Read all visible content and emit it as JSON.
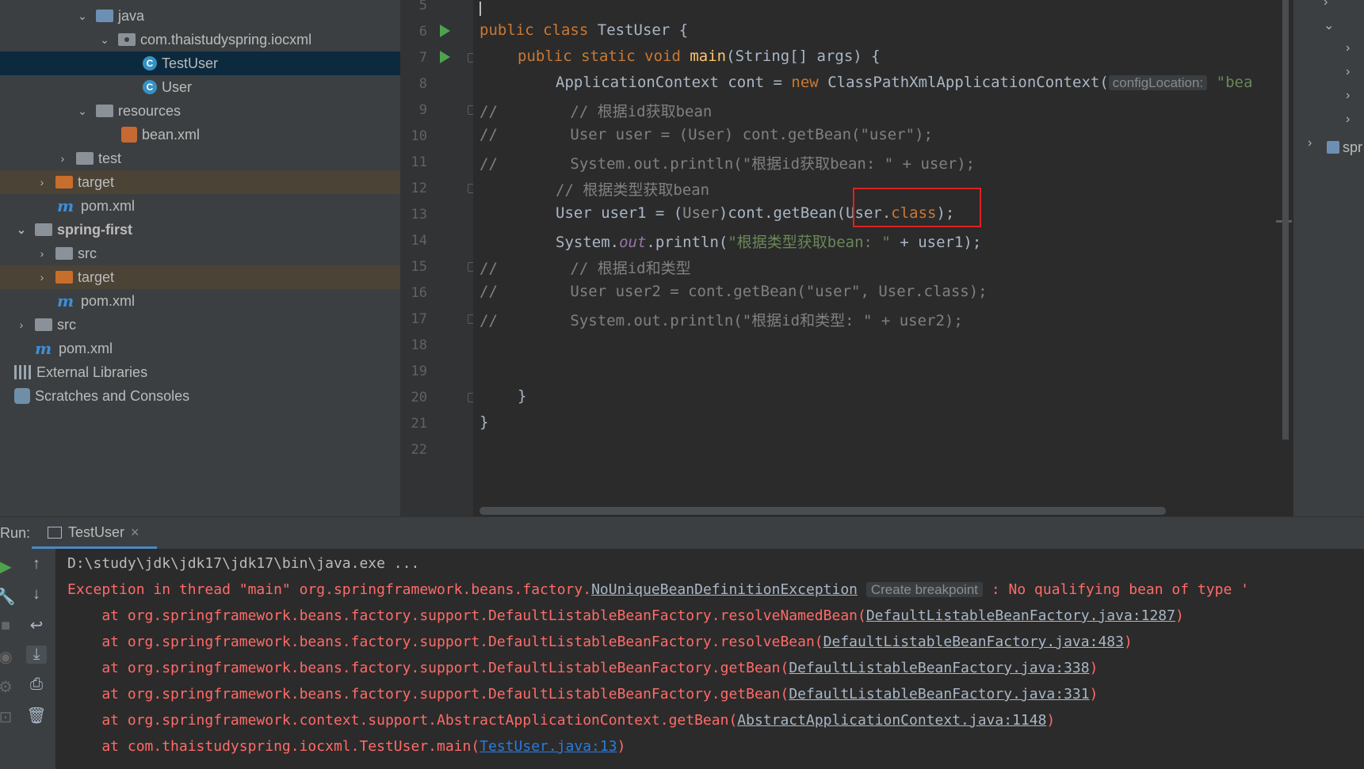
{
  "tree": [
    {
      "label": "java",
      "kind": "folder-blue",
      "expanded": true
    },
    {
      "label": "com.thaistudyspring.iocxml",
      "kind": "package",
      "expanded": true
    },
    {
      "label": "TestUser",
      "kind": "class",
      "selected": true
    },
    {
      "label": "User",
      "kind": "class"
    },
    {
      "label": "resources",
      "kind": "folder-res",
      "expanded": true
    },
    {
      "label": "bean.xml",
      "kind": "xml"
    },
    {
      "label": "test",
      "kind": "folder-gray",
      "expanded": false
    },
    {
      "label": "target",
      "kind": "folder-orange",
      "expanded": false
    },
    {
      "label": "pom.xml",
      "kind": "maven"
    },
    {
      "label": "spring-first",
      "kind": "module",
      "expanded": true
    },
    {
      "label": "src",
      "kind": "folder-gray",
      "expanded": false
    },
    {
      "label": "target",
      "kind": "folder-orange",
      "expanded": false
    },
    {
      "label": "pom.xml",
      "kind": "maven"
    },
    {
      "label": "src",
      "kind": "folder-gray",
      "expanded": false
    },
    {
      "label": "pom.xml",
      "kind": "maven"
    },
    {
      "label": "External Libraries",
      "kind": "libraries",
      "expanded": false
    },
    {
      "label": "Scratches and Consoles",
      "kind": "scratches",
      "expanded": false
    }
  ],
  "editor": {
    "line_numbers": [
      "5",
      "6",
      "7",
      "8",
      "9",
      "10",
      "11",
      "12",
      "13",
      "14",
      "15",
      "16",
      "17",
      "18",
      "19",
      "20",
      "21",
      "22"
    ],
    "l6": {
      "kw1": "public",
      "kw2": "class",
      "name": "TestUser",
      "rest": " {"
    },
    "l7": {
      "kw": "public static void",
      "fn": "main",
      "rest": "(String[] args) {"
    },
    "l8": {
      "pre": "ApplicationContext cont = ",
      "kw": "new",
      "post": " ClassPathXmlApplicationContext(",
      "hint": "configLocation:",
      "str": "\"bea"
    },
    "l9": {
      "a": "//",
      "b": "// 根据id获取bean"
    },
    "l10": {
      "a": "//",
      "b": "User user = (User) cont.getBean(\"user\");"
    },
    "l11": {
      "a": "//",
      "b": "System.out.println(\"根据id获取bean: \" + user);"
    },
    "l12": {
      "text": "// 根据类型获取bean"
    },
    "l13": {
      "a": "User user1 = (",
      "b": "User",
      "c": ")cont.getBean(User.",
      "d": "class",
      "e": ");"
    },
    "l14": {
      "a": "System.",
      "b": "out",
      "c": ".println(",
      "d": "\"根据类型获取bean: \"",
      "e": " + user1);"
    },
    "l15": {
      "a": "//",
      "b": "// 根据id和类型"
    },
    "l16": {
      "a": "//",
      "b": "User user2 = cont.getBean(\"user\", User.class);"
    },
    "l17": {
      "a": "//",
      "b": "System.out.println(\"根据id和类型: \" + user2);"
    },
    "l20": "}",
    "l21": "}"
  },
  "right_panel": {
    "label": "spr"
  },
  "run": {
    "label": "Run:",
    "tab": "TestUser",
    "close": "×",
    "lines": {
      "cmd": "D:\\study\\jdk\\jdk17\\jdk17\\bin\\java.exe ...",
      "ex_pre": "Exception in thread \"main\" org.springframework.beans.factory.",
      "ex_link": "NoUniqueBeanDefinitionException",
      "ex_bp": "Create breakpoint",
      "ex_post": ": No qualifying bean of type '",
      "s1_pre": "    at org.springframework.beans.factory.support.DefaultListableBeanFactory.resolveNamedBean(",
      "s1_link": "DefaultListableBeanFactory.java:1287",
      "s1_post": ")",
      "s2_pre": "    at org.springframework.beans.factory.support.DefaultListableBeanFactory.resolveBean(",
      "s2_link": "DefaultListableBeanFactory.java:483",
      "s2_post": ")",
      "s3_pre": "    at org.springframework.beans.factory.support.DefaultListableBeanFactory.getBean(",
      "s3_link": "DefaultListableBeanFactory.java:338",
      "s3_post": ")",
      "s4_pre": "    at org.springframework.beans.factory.support.DefaultListableBeanFactory.getBean(",
      "s4_link": "DefaultListableBeanFactory.java:331",
      "s4_post": ")",
      "s5_pre": "    at org.springframework.context.support.AbstractApplicationContext.getBean(",
      "s5_link": "AbstractApplicationContext.java:1148",
      "s5_post": ")",
      "s6_pre": "    at com.thaistudyspring.iocxml.TestUser.main(",
      "s6_link": "TestUser.java:13",
      "s6_post": ")"
    }
  },
  "colors": {
    "error": "#ff6b68",
    "selection": "#0d293e",
    "highlight_box": "#e02020"
  }
}
